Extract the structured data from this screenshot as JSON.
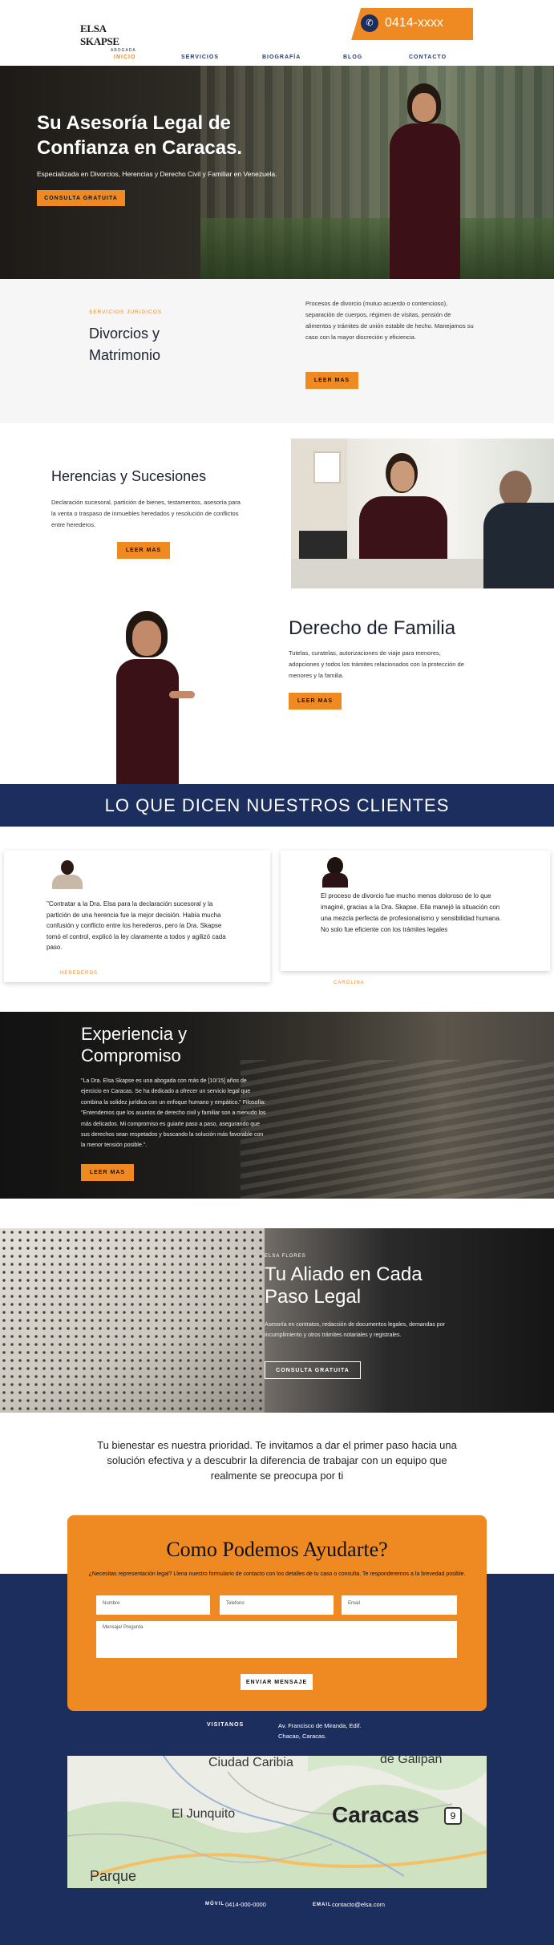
{
  "header": {
    "logo_name": "ELSA SKAPSE",
    "logo_sub": "ABOGADA",
    "phone": "0414-xxxx",
    "nav": [
      "INICIO",
      "SERVICIOS",
      "BIOGRAFÍA",
      "BLOG",
      "CONTACTO"
    ]
  },
  "hero": {
    "title": "Su Asesoría Legal de Confianza en Caracas.",
    "subtitle": "Especializada en Divorcios, Herencias y Derecho Civil y Familiar en Venezuela.",
    "cta": "CONSULTA GRATUITA"
  },
  "divorce": {
    "eyebrow": "SERVICIOS JURIDICOS",
    "title": "Divorcios y Matrimonio",
    "text": "Procesos de divorcio (mutuo acuerdo o contencioso), separación de cuerpos, régimen de visitas, pensión de alimentos y trámites de unión estable de hecho. Manejamos su caso con la mayor discreción y eficiencia.",
    "button": "LEER MAS"
  },
  "inheritance": {
    "title": "Herencias y Sucesiones",
    "text": "Declaración sucesoral, partición de bienes, testamentos, asesoría para la venta o traspaso de inmuebles heredados y resolución de conflictos entre herederos.",
    "button": "LEER MAS"
  },
  "family": {
    "title": "Derecho de Familia",
    "text": "Tutelas, curatelas, autorizaciones de viaje para menores, adopciones y todos los trámites relacionados con la protección de menores y la familia.",
    "button": "LEER MAS"
  },
  "testimonials": {
    "heading": "LO QUE DICEN NUESTROS CLIENTES",
    "items": [
      {
        "quote": "\"Contratar a la Dra. Elsa para la declaración sucesoral y la partición de una herencia fue la mejor decisión. Había mucha confusión y conflicto entre los herederos, pero la Dra. Skapse tomó el control, explicó la ley claramente a todos y agilizó cada paso.",
        "author": "HEREDEROS"
      },
      {
        "quote": "El proceso de divorcio fue mucho menos doloroso de lo que imaginé, gracias a la Dra. Skapse. Ella manejó la situación con una mezcla perfecta de profesionalismo y sensibilidad humana. No solo fue eficiente con los trámites legales",
        "author": "CAROLINA"
      }
    ]
  },
  "experience": {
    "title": "Experiencia y Compromiso",
    "text": "\"La Dra. Elsa Skapse es una abogada con más de [10/15] años de ejercicio en Caracas. Se ha dedicado a ofrecer un servicio legal que combina la solidez jurídica con un enfoque humano y empático.\" Filosofía: \"Entendemos que los asuntos de derecho civil y familiar son a menudo los más delicados. Mi compromiso es guiarle paso a paso, asegurando que sus derechos sean respetados y buscando la solución más favorable con la menor tensión posible.\".",
    "button": "LEER MAS"
  },
  "ally": {
    "eyebrow": "ELSA FLORES",
    "title": "Tu Aliado en Cada Paso Legal",
    "text": "Asesoría en contratos, redacción de documentos legales, demandas por incumplimiento y otros trámites notariales y registrales.",
    "button": "CONSULTA GRATUITA"
  },
  "wellbeing": "Tu bienestar es nuestra prioridad. Te invitamos a dar el primer paso hacia una solución efectiva y a descubrir la diferencia de trabajar con un equipo que realmente se preocupa por ti",
  "contact": {
    "title": "Como Podemos Ayudarte?",
    "intro": "¿Necesitas representación legal? Llena nuestro formulario de contacto con los detalles de tu caso o consulta. Te responderemos a la brevedad posible.",
    "name_ph": "Nombre",
    "phone_ph": "Telefono",
    "email_ph": "Email",
    "message_ph": "Mensaje/ Pregunta",
    "submit": "ENVIAR MENSAJE"
  },
  "visit": {
    "label": "VISITANOS",
    "address": "Av. Francisco de Miranda, Edif. Chacao, Caracas."
  },
  "map": {
    "labels": [
      "Ciudad Caribia",
      "de Galipán",
      "El Junquito",
      "Caracas",
      "9",
      "Parque"
    ]
  },
  "footer": {
    "mobile_label": "MÓVIL",
    "mobile": "0414-000-0000",
    "email_label": "EMAIL",
    "email": "contacto@elsa.com"
  },
  "colors": {
    "accent": "#ef8a22",
    "navy": "#1c2e5e",
    "dark": "#151515"
  }
}
